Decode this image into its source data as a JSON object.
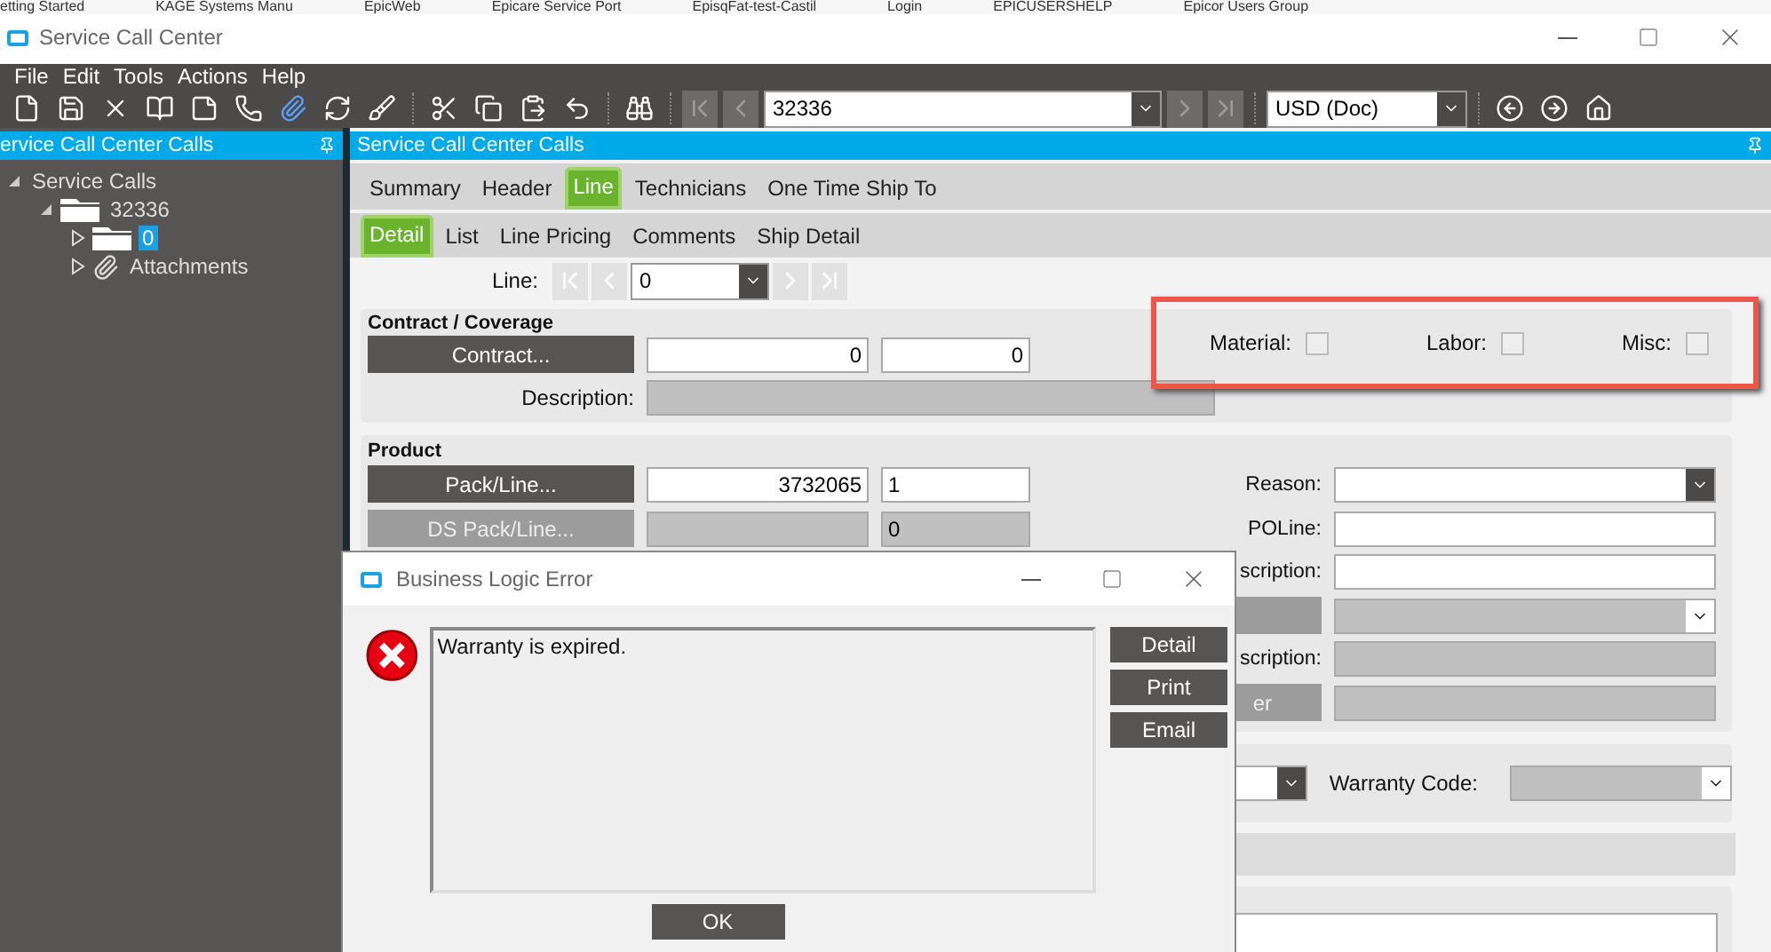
{
  "bookmarks": [
    "etting Started",
    "KAGE Systems Manu",
    "EpicWeb",
    "Epicare Service Port",
    "EpisqFat-test-Castil",
    "Login",
    "EPICUSERSHELP",
    "Epicor Users Group"
  ],
  "window": {
    "title": "Service Call Center"
  },
  "menu": [
    "File",
    "Edit",
    "Tools",
    "Actions",
    "Help"
  ],
  "toolbar": {
    "record": "32336",
    "currency": "USD (Doc)"
  },
  "tree_panel": {
    "title": "ervice Call Center Calls",
    "tree": [
      {
        "label": "Service Calls",
        "expanded": true,
        "selected": false,
        "children": [
          {
            "label": "32336",
            "kind": "folder",
            "expanded": true,
            "selected": false,
            "children": [
              {
                "label": "0",
                "kind": "folder",
                "expanded": false,
                "selected": true
              },
              {
                "label": "Attachments",
                "kind": "attachment",
                "expanded": false,
                "selected": false
              }
            ]
          }
        ]
      }
    ]
  },
  "form_panel": {
    "title": "Service Call Center Calls",
    "tabs": [
      {
        "label": "Summary",
        "selected": false
      },
      {
        "label": "Header",
        "selected": false
      },
      {
        "label": "Line",
        "selected": true
      },
      {
        "label": "Technicians",
        "selected": false
      },
      {
        "label": "One Time Ship To",
        "selected": false
      }
    ],
    "subtabs": [
      {
        "label": "Detail",
        "selected": true
      },
      {
        "label": "List",
        "selected": false
      },
      {
        "label": "Line Pricing",
        "selected": false
      },
      {
        "label": "Comments",
        "selected": false
      },
      {
        "label": "Ship Detail",
        "selected": false
      }
    ],
    "line": {
      "label": "Line:",
      "value": "0"
    },
    "contract": {
      "title": "Contract / Coverage",
      "button": "Contract...",
      "value_1": "0",
      "value_2": "0",
      "description_label": "Description:",
      "flags": [
        {
          "label": "Material:",
          "checked": false
        },
        {
          "label": "Labor:",
          "checked": false
        },
        {
          "label": "Misc:",
          "checked": false
        }
      ]
    },
    "product": {
      "title": "Product",
      "buttons": [
        {
          "label": "Pack/Line...",
          "disabled": false
        },
        {
          "label": "DS Pack/Line...",
          "disabled": true
        }
      ],
      "pack_value": "3732065",
      "pack_qty": "1",
      "ds_qty": "0",
      "fields": [
        {
          "label": "Reason:",
          "kind": "dropdown",
          "disabled": false
        },
        {
          "label": "POLine:",
          "kind": "text",
          "disabled": false
        },
        {
          "label": "scription:",
          "kind": "text",
          "disabled": false
        },
        {
          "lookup_button": true,
          "kind": "dropdown",
          "disabled": true
        },
        {
          "label": "scription:",
          "kind": "text",
          "disabled": true
        },
        {
          "button_label": "er",
          "kind": "text",
          "disabled": true
        }
      ]
    },
    "warranty": {
      "label": "Warranty Code:"
    }
  },
  "dialog": {
    "title": "Business Logic Error",
    "message": "Warranty is expired.",
    "buttons": [
      "Detail",
      "Print",
      "Email"
    ],
    "ok": "OK"
  }
}
